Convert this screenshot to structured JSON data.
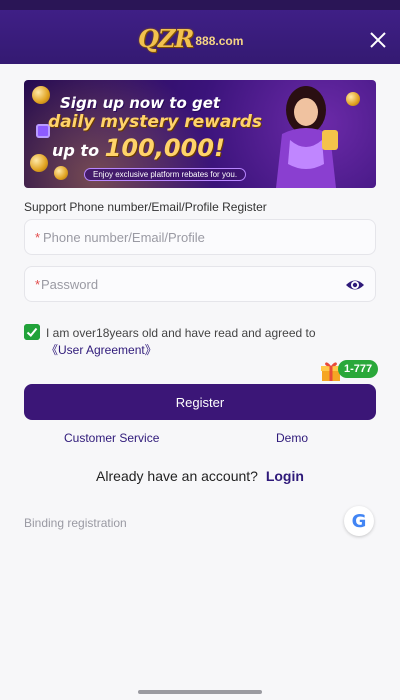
{
  "header": {
    "logo_mark": "QZR",
    "logo_suffix": "888.com",
    "close_icon": "close-icon"
  },
  "banner": {
    "line1": "Sign up now to get",
    "line2": "daily mystery rewards",
    "line3_prefix": "up to",
    "line3_amount": "100,000!",
    "line4": "Enjoy exclusive platform rebates for you."
  },
  "form": {
    "support_label": "Support Phone number/Email/Profile Register",
    "account_star": "*",
    "account_placeholder": "Phone number/Email/Profile",
    "password_star": "*",
    "password_placeholder": "Password",
    "eye_icon": "eye-icon",
    "agree_text": "I am over18years old and have read and agreed to ",
    "agree_link": "《User Agreement》",
    "checkbox_checked": true,
    "checkbox_color": "#21a23a"
  },
  "promo": {
    "gift_icon": "gift-icon",
    "badge": "1-777"
  },
  "actions": {
    "register_label": "Register",
    "customer_service": "Customer Service",
    "demo": "Demo",
    "already_text": "Already have an account?",
    "login_label": "Login",
    "binding_label": "Binding registration",
    "google_letter": "G"
  },
  "colors": {
    "header": "#3f1f86",
    "primary": "#3b1677",
    "link": "#2f1a7a",
    "check": "#21a23a"
  }
}
